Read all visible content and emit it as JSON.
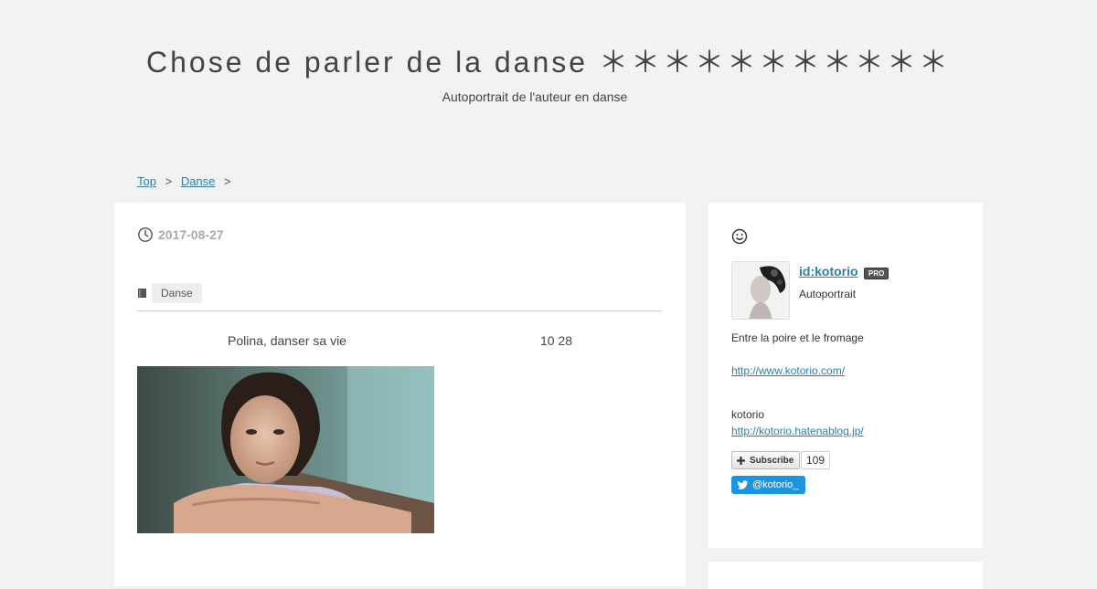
{
  "header": {
    "title": "Chose de parler de la danse ＊＊＊＊＊＊＊＊＊＊＊",
    "description": "Autoportrait de l'auteur en danse"
  },
  "breadcrumb": {
    "items": [
      {
        "label": "Top"
      },
      {
        "label": "Danse"
      }
    ],
    "separator": ">"
  },
  "entry": {
    "date": "2017-08-27",
    "category": "Danse",
    "title_line": "Polina, danser sa vie",
    "date_line": "10  28"
  },
  "sidebar": {
    "user_id": "id:kotorio",
    "pro_badge": "PRO",
    "user_desc": "Autoportrait",
    "bio": "Entre la poire et le fromage",
    "link1": "http://www.kotorio.com/",
    "name": "kotorio",
    "link2": "http://kotorio.hatenablog.jp/",
    "subscribe_label": "Subscribe",
    "subscribe_count": "109",
    "twitter_label": "@kotorio_"
  },
  "icons": [
    "clock-icon",
    "folder-icon",
    "smile-icon",
    "plus-icon",
    "twitter-bird-icon"
  ],
  "colors": {
    "link": "#2a7fb0",
    "twitter": "#1b95e0",
    "background": "#f2f2f2"
  }
}
